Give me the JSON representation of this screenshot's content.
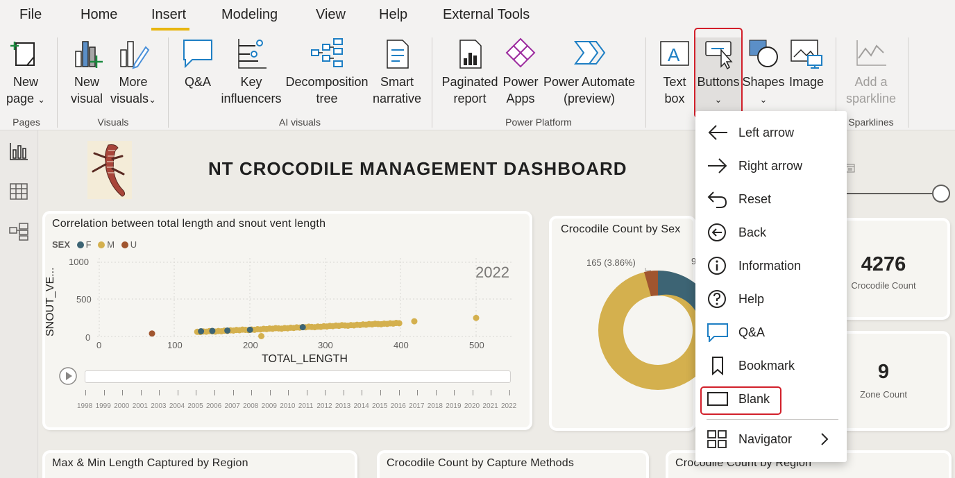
{
  "menu": {
    "tabs": [
      {
        "label": "File"
      },
      {
        "label": "Home"
      },
      {
        "label": "Insert"
      },
      {
        "label": "Modeling"
      },
      {
        "label": "View"
      },
      {
        "label": "Help"
      },
      {
        "label": "External Tools"
      }
    ]
  },
  "ribbon": {
    "new_page": {
      "line1": "New",
      "line2": "page"
    },
    "new_visual": {
      "line1": "New",
      "line2": "visual"
    },
    "more_visuals": {
      "line1": "More",
      "line2": "visuals"
    },
    "qa": {
      "line1": "Q&A"
    },
    "key_influencers": {
      "line1": "Key",
      "line2": "influencers"
    },
    "decomposition_tree": {
      "line1": "Decomposition",
      "line2": "tree"
    },
    "smart_narrative": {
      "line1": "Smart",
      "line2": "narrative"
    },
    "paginated_report": {
      "line1": "Paginated",
      "line2": "report"
    },
    "power_apps": {
      "line1": "Power",
      "line2": "Apps"
    },
    "power_automate": {
      "line1": "Power Automate",
      "line2": "(preview)"
    },
    "text_box": {
      "line1": "Text",
      "line2": "box"
    },
    "buttons": {
      "line1": "Buttons"
    },
    "shapes": {
      "line1": "Shapes"
    },
    "image": {
      "line1": "Image"
    },
    "sparkline": {
      "line1": "Add a",
      "line2": "sparkline"
    },
    "groups": {
      "pages": "Pages",
      "visuals": "Visuals",
      "ai_visuals": "AI visuals",
      "power_platform": "Power Platform",
      "sparklines": "Sparklines"
    }
  },
  "dashboard": {
    "title": "NT CROCODILE MANAGEMENT DASHBOARD",
    "scatter": {
      "title": "Correlation between total length and snout vent length",
      "legend_title": "SEX",
      "legend": [
        {
          "label": "F",
          "color": "#3d6474"
        },
        {
          "label": "M",
          "color": "#d4b04e"
        },
        {
          "label": "U",
          "color": "#a0552f"
        }
      ],
      "year": "2022",
      "x_title": "TOTAL_LENGTH",
      "y_title": "SNOUT_VE...",
      "y_ticks": [
        "1000",
        "500",
        "0"
      ],
      "x_ticks": [
        "0",
        "100",
        "200",
        "300",
        "400",
        "500"
      ],
      "timeline_years": [
        "1998",
        "1999",
        "2000",
        "2001",
        "2003",
        "2004",
        "2005",
        "2006",
        "2007",
        "2008",
        "2009",
        "2010",
        "2011",
        "2012",
        "2013",
        "2014",
        "2015",
        "2016",
        "2017",
        "2018",
        "2019",
        "2020",
        "2021",
        "2022"
      ]
    },
    "donut": {
      "title": "Crocodile Count by Sex",
      "label_u": "165 (3.86%)",
      "label_partial": "9"
    },
    "kpi_count": {
      "value": "4276",
      "label": "Crocodile Count"
    },
    "kpi_zone": {
      "value": "9",
      "label": "Zone Count"
    },
    "bottom_cards": {
      "region_len": "Max & Min Length Captured by Region",
      "capture": "Crocodile Count by Capture Methods",
      "region_count": "Crocodile Count by Region"
    }
  },
  "buttons_menu": {
    "items": [
      {
        "label": "Left arrow",
        "icon": "left-arrow-icon"
      },
      {
        "label": "Right arrow",
        "icon": "right-arrow-icon"
      },
      {
        "label": "Reset",
        "icon": "reset-icon"
      },
      {
        "label": "Back",
        "icon": "back-icon"
      },
      {
        "label": "Information",
        "icon": "information-icon"
      },
      {
        "label": "Help",
        "icon": "help-icon"
      },
      {
        "label": "Q&A",
        "icon": "qa-icon"
      },
      {
        "label": "Bookmark",
        "icon": "bookmark-icon"
      },
      {
        "label": "Blank",
        "icon": "blank-icon"
      },
      {
        "label": "Navigator",
        "icon": "navigator-icon"
      }
    ]
  },
  "colors": {
    "accent_tab": "#e8b610",
    "highlight": "#d21f2a",
    "female": "#3d6474",
    "male": "#d4b04e",
    "unknown": "#a0552f"
  }
}
